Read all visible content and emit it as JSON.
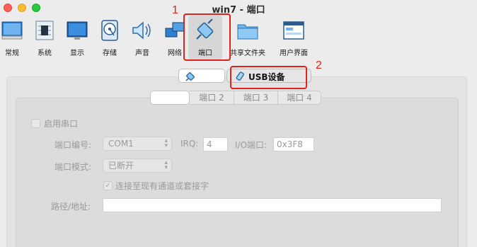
{
  "window": {
    "title": "win7 - 端口"
  },
  "toolbar": {
    "items": [
      {
        "label": "常规",
        "icon": "general-icon"
      },
      {
        "label": "系统",
        "icon": "system-chip-icon"
      },
      {
        "label": "显示",
        "icon": "display-monitor-icon"
      },
      {
        "label": "存储",
        "icon": "storage-disk-icon"
      },
      {
        "label": "声音",
        "icon": "speaker-icon"
      },
      {
        "label": "网络",
        "icon": "network-icon"
      },
      {
        "label": "端口",
        "icon": "port-plug-icon",
        "selected": true
      },
      {
        "label": "共享文件夹",
        "icon": "shared-folder-icon"
      },
      {
        "label": "用户界面",
        "icon": "user-interface-icon"
      }
    ]
  },
  "annotations": {
    "mark1": "1",
    "mark2": "2",
    "color": "#e0231d"
  },
  "top_tabs": {
    "serial_icon": "serial-port-icon",
    "usb_icon": "usb-icon",
    "usb_label": "USB设备"
  },
  "port_tabs": [
    "",
    "端口 2",
    "端口 3",
    "端口 4"
  ],
  "form": {
    "enable_label": "启用串口",
    "port_number_label": "端口编号:",
    "port_number_value": "COM1",
    "irq_label": "IRQ:",
    "irq_value": "4",
    "io_label": "I/O端口:",
    "io_value": "0x3F8",
    "port_mode_label": "端口模式:",
    "port_mode_value": "已断开",
    "connect_existing_label": "连接至现有通道或套接字",
    "path_label": "路径/地址:",
    "path_value": ""
  }
}
